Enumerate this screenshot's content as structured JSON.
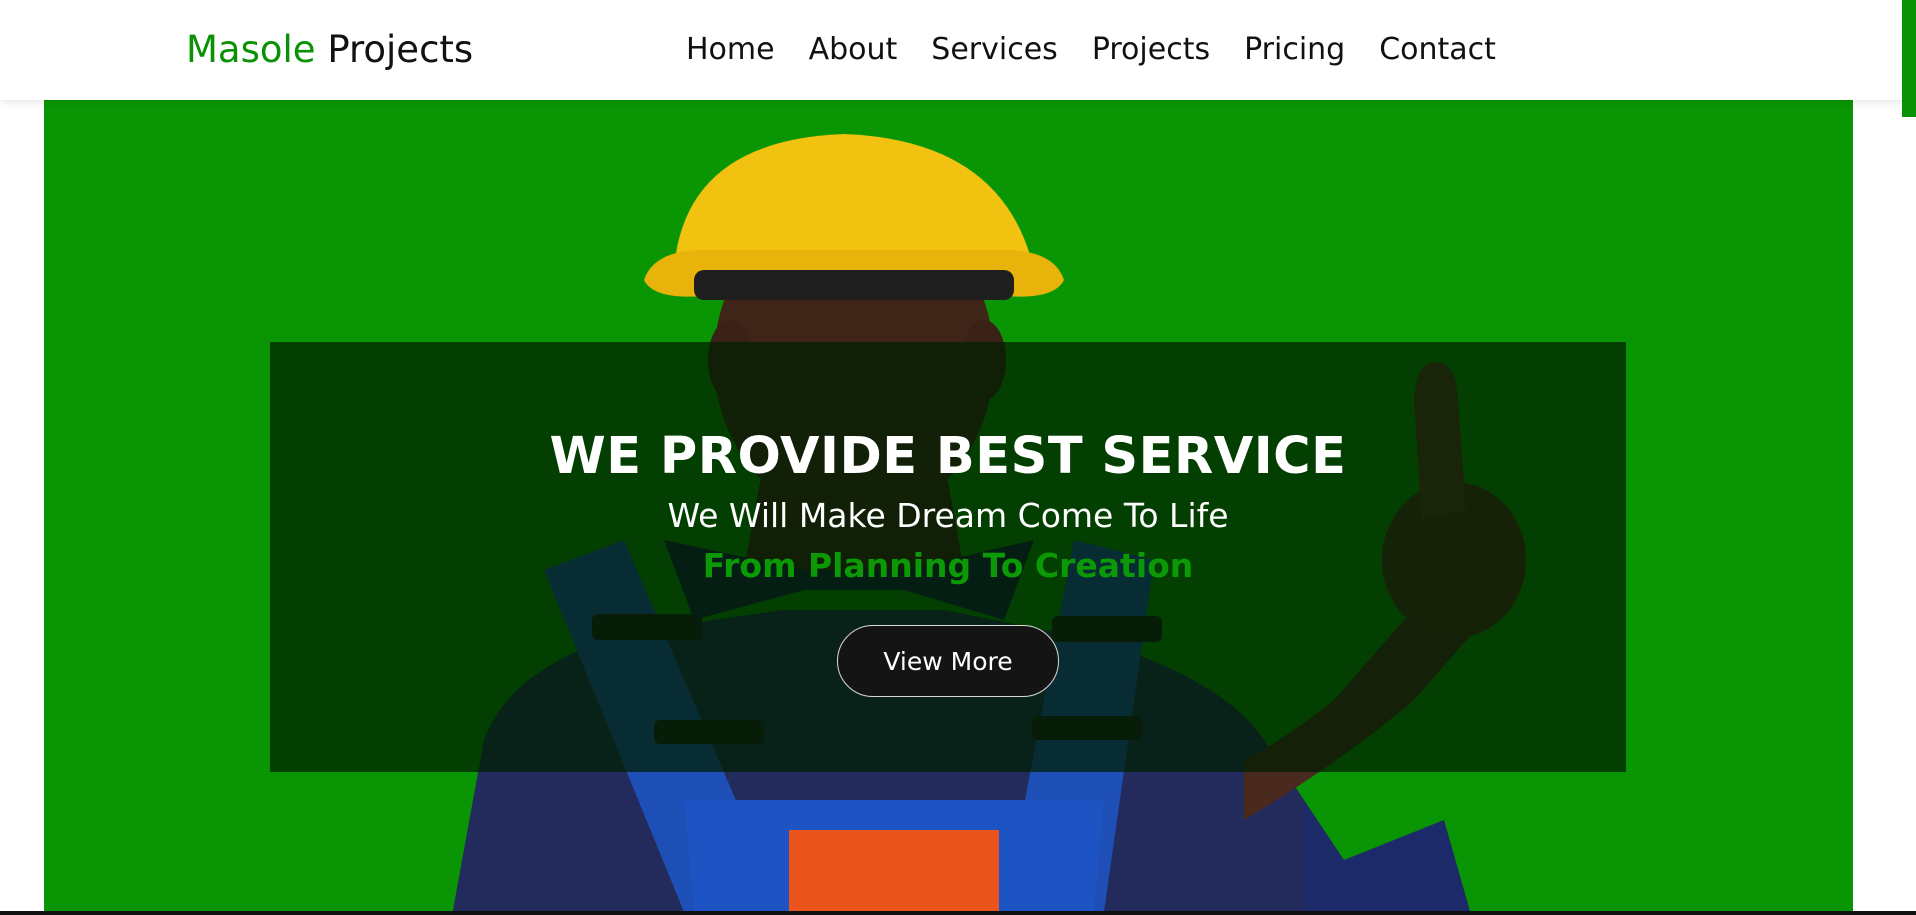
{
  "brand": {
    "accent": "Masole",
    "rest": " Projects"
  },
  "nav": {
    "items": [
      "Home",
      "About",
      "Services",
      "Projects",
      "Pricing",
      "Contact"
    ]
  },
  "hero": {
    "title": "WE PROVIDE BEST SERVICE",
    "subtitle": "We Will Make Dream Come To Life",
    "tagline": "From Planning To Creation",
    "button_label": "View More"
  },
  "colors": {
    "brand_green": "#0b9204",
    "hero_background": "#0a9504",
    "panel_overlay": "rgba(0,30,0,0.72)",
    "button_background": "#141414"
  },
  "icons": [
    "construction-worker-image"
  ]
}
